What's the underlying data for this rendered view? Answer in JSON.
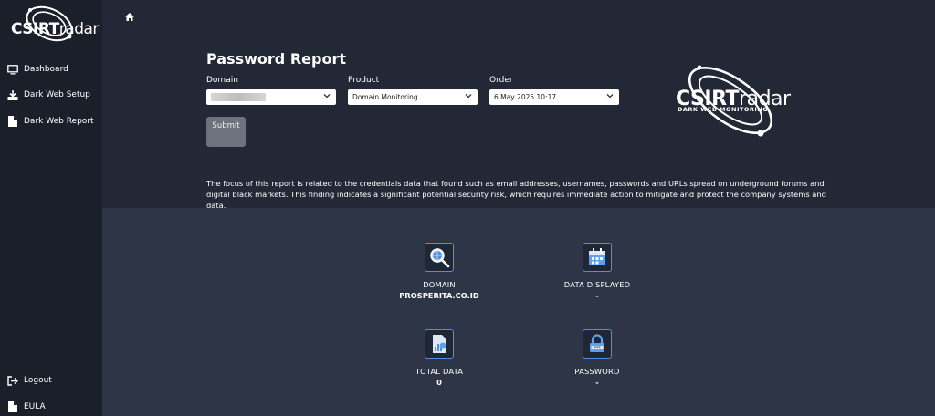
{
  "sidebar": {
    "logo": {
      "bold": "CSIRT",
      "light": "radar"
    },
    "items": [
      {
        "label": "Dashboard",
        "icon": "monitor-icon"
      },
      {
        "label": "Dark Web Setup",
        "icon": "download-icon"
      },
      {
        "label": "Dark Web Report",
        "icon": "file-icon"
      }
    ],
    "bottom": [
      {
        "label": "Logout",
        "icon": "logout-icon"
      },
      {
        "label": "EULA",
        "icon": "file-icon"
      }
    ]
  },
  "page": {
    "title": "Password Report",
    "domain_label": "Domain",
    "product_label": "Product",
    "product_value": "Domain Monitoring",
    "order_label": "Order",
    "order_value": "6 May 2025 10:17",
    "submit_label": "Submit",
    "description": "The focus of this report is related to the credentials data that found such as email addresses, usernames, passwords and URLs spread on underground forums and digital black markets. This finding indicates a significant potential security risk, which requires immediate action to mitigate and protect the company systems and data.",
    "brand_logo": {
      "bold": "CSIRT",
      "light": "radar",
      "tagline": "DARK WEB MONITORING"
    }
  },
  "stats": {
    "domain": {
      "label": "DOMAIN",
      "value": "PROSPERITA.CO.ID",
      "icon": "magnifier-globe-icon"
    },
    "data_displayed": {
      "label": "DATA DISPLAYED",
      "value": "-",
      "icon": "calendar-icon"
    },
    "total_data": {
      "label": "TOTAL DATA",
      "value": "0",
      "icon": "document-chart-icon"
    },
    "password": {
      "label": "PASSWORD",
      "value": "-",
      "icon": "lock-icon"
    }
  },
  "colors": {
    "sidebar": "#1b1f2a",
    "top": "#232836",
    "content": "#2e3546",
    "accent": "#4e8fde"
  }
}
